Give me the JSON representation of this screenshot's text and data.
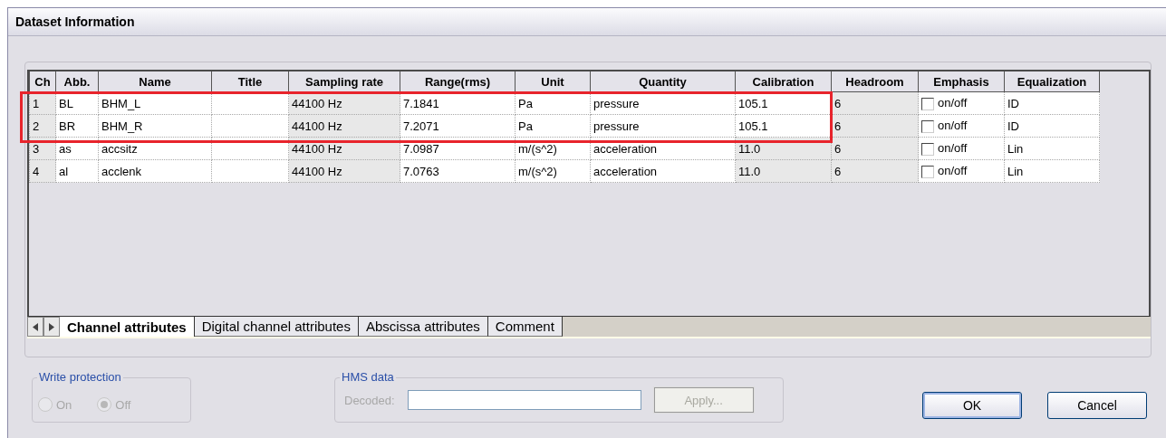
{
  "window": {
    "title": "Dataset Information"
  },
  "table": {
    "columns": [
      {
        "label": "Ch",
        "shaded": true
      },
      {
        "label": "Abb.",
        "shaded": false
      },
      {
        "label": "Name",
        "shaded": false
      },
      {
        "label": "Title",
        "shaded": false
      },
      {
        "label": "Sampling rate",
        "shaded": true
      },
      {
        "label": "Range(rms)",
        "shaded": false
      },
      {
        "label": "Unit",
        "shaded": false
      },
      {
        "label": "Quantity",
        "shaded": false
      },
      {
        "label": "Calibration",
        "shaded": false
      },
      {
        "label": "Headroom",
        "shaded": true
      },
      {
        "label": "Emphasis",
        "shaded": false
      },
      {
        "label": "Equalization",
        "shaded": false
      }
    ],
    "rows": [
      {
        "highlighted": true,
        "calibration_locked": false,
        "emphasis_checked": false,
        "cells": [
          "1",
          "BL",
          "BHM_L",
          "",
          "44100 Hz",
          "7.1841",
          "Pa",
          "pressure",
          "105.1",
          "6",
          "on/off",
          "ID"
        ]
      },
      {
        "highlighted": true,
        "calibration_locked": false,
        "emphasis_checked": false,
        "cells": [
          "2",
          "BR",
          "BHM_R",
          "",
          "44100 Hz",
          "7.2071",
          "Pa",
          "pressure",
          "105.1",
          "6",
          "on/off",
          "ID"
        ]
      },
      {
        "highlighted": false,
        "calibration_locked": true,
        "emphasis_checked": false,
        "cells": [
          "3",
          "as",
          "accsitz",
          "",
          "44100 Hz",
          "7.0987",
          "m/(s^2)",
          "acceleration",
          "11.0",
          "6",
          "on/off",
          "Lin"
        ]
      },
      {
        "highlighted": false,
        "calibration_locked": true,
        "emphasis_checked": false,
        "cells": [
          "4",
          "al",
          "acclenk",
          "",
          "44100 Hz",
          "7.0763",
          "m/(s^2)",
          "acceleration",
          "11.0",
          "6",
          "on/off",
          "Lin"
        ]
      }
    ]
  },
  "sheet_tabs": [
    {
      "label": "Channel attributes",
      "selected": true
    },
    {
      "label": "Digital channel attributes",
      "selected": false
    },
    {
      "label": "Abscissa attributes",
      "selected": false
    },
    {
      "label": "Comment",
      "selected": false
    }
  ],
  "write_protection": {
    "label": "Write protection",
    "options": [
      {
        "label": "On",
        "selected": false,
        "disabled": true
      },
      {
        "label": "Off",
        "selected": true,
        "disabled": true
      }
    ]
  },
  "hms_data": {
    "label": "HMS data",
    "field_label": "Decoded:",
    "apply": {
      "label": "Apply...",
      "disabled": true
    }
  },
  "buttons": [
    {
      "label": "OK",
      "kind": "default"
    },
    {
      "label": "Cancel",
      "kind": "normal"
    }
  ]
}
